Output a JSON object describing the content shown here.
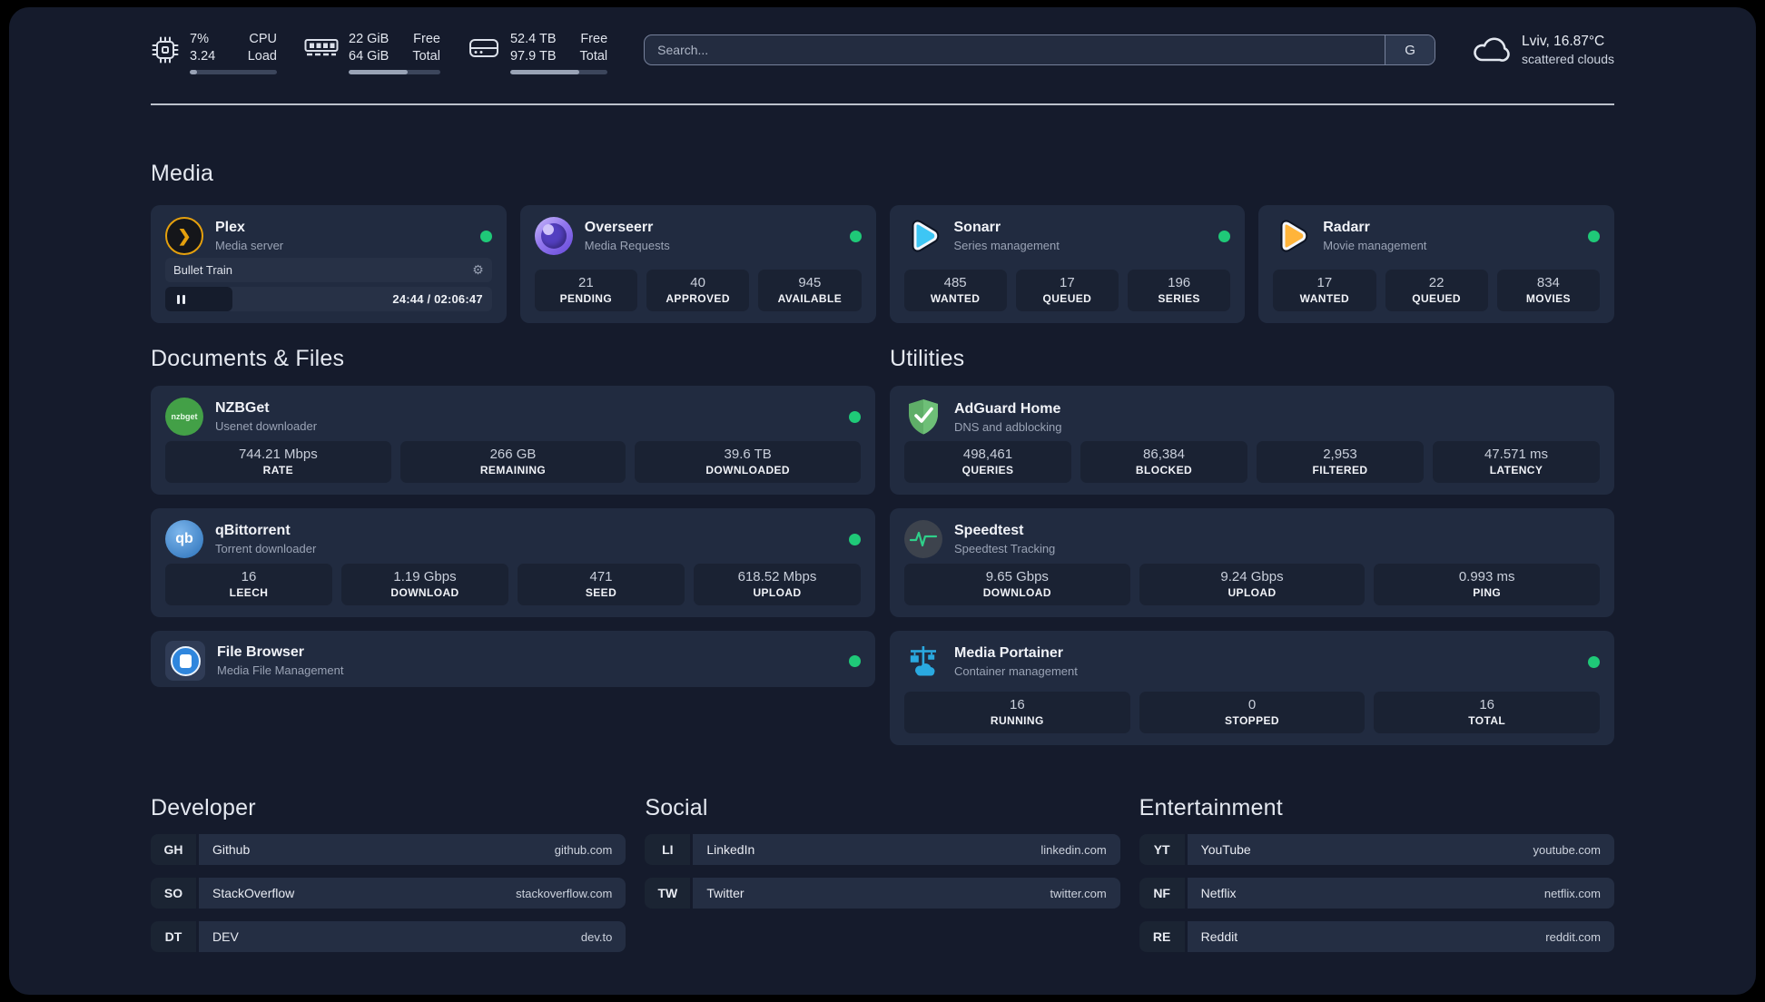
{
  "theme": {
    "background": "#151b2c",
    "card": "#212b40",
    "stat_box": "#1a2233",
    "status_online_green": "#1fc978",
    "text_primary": "#f1f3f8",
    "text_secondary": "#9aa3b5"
  },
  "icons": {
    "pause": "pause-icon",
    "gear": "⚙",
    "plex_glyph": "❯"
  },
  "topbar": {
    "cpu": {
      "values": [
        "7%",
        "3.24"
      ],
      "labels": [
        "CPU",
        "Load"
      ],
      "progress_pct": 8
    },
    "memory": {
      "values": [
        "22 GiB",
        "64 GiB"
      ],
      "labels": [
        "Free",
        "Total"
      ],
      "progress_pct": 64
    },
    "disk": {
      "values": [
        "52.4 TB",
        "97.9 TB"
      ],
      "labels": [
        "Free",
        "Total"
      ],
      "progress_pct": 71
    },
    "search": {
      "placeholder": "Search...",
      "provider": "G"
    },
    "weather": {
      "line1": "Lviv, 16.87°C",
      "line2": "scattered clouds"
    }
  },
  "sections": {
    "media": {
      "title": "Media"
    },
    "documents": {
      "title": "Documents & Files"
    },
    "utilities": {
      "title": "Utilities"
    }
  },
  "services": {
    "plex": {
      "name": "Plex",
      "desc": "Media server",
      "icon_text": "❯",
      "now_playing": {
        "title": "Bullet Train",
        "time": "24:44 / 02:06:47"
      }
    },
    "overseerr": {
      "name": "Overseerr",
      "desc": "Media Requests",
      "stats": [
        {
          "value": "21",
          "label": "PENDING"
        },
        {
          "value": "40",
          "label": "APPROVED"
        },
        {
          "value": "945",
          "label": "AVAILABLE"
        }
      ]
    },
    "sonarr": {
      "name": "Sonarr",
      "desc": "Series management",
      "stats": [
        {
          "value": "485",
          "label": "WANTED"
        },
        {
          "value": "17",
          "label": "QUEUED"
        },
        {
          "value": "196",
          "label": "SERIES"
        }
      ]
    },
    "radarr": {
      "name": "Radarr",
      "desc": "Movie management",
      "stats": [
        {
          "value": "17",
          "label": "WANTED"
        },
        {
          "value": "22",
          "label": "QUEUED"
        },
        {
          "value": "834",
          "label": "MOVIES"
        }
      ]
    },
    "nzbget": {
      "name": "NZBGet",
      "desc": "Usenet downloader",
      "icon_text": "nzbget",
      "stats": [
        {
          "value": "744.21 Mbps",
          "label": "RATE"
        },
        {
          "value": "266 GB",
          "label": "REMAINING"
        },
        {
          "value": "39.6 TB",
          "label": "DOWNLOADED"
        }
      ]
    },
    "qbittorrent": {
      "name": "qBittorrent",
      "desc": "Torrent downloader",
      "icon_text": "qb",
      "stats": [
        {
          "value": "16",
          "label": "LEECH"
        },
        {
          "value": "1.19 Gbps",
          "label": "DOWNLOAD"
        },
        {
          "value": "471",
          "label": "SEED"
        },
        {
          "value": "618.52 Mbps",
          "label": "UPLOAD"
        }
      ]
    },
    "filebrowser": {
      "name": "File Browser",
      "desc": "Media File Management"
    },
    "adguard": {
      "name": "AdGuard Home",
      "desc": "DNS and adblocking",
      "stats": [
        {
          "value": "498,461",
          "label": "QUERIES"
        },
        {
          "value": "86,384",
          "label": "BLOCKED"
        },
        {
          "value": "2,953",
          "label": "FILTERED"
        },
        {
          "value": "47.571 ms",
          "label": "LATENCY"
        }
      ]
    },
    "speedtest": {
      "name": "Speedtest",
      "desc": "Speedtest Tracking",
      "stats": [
        {
          "value": "9.65 Gbps",
          "label": "DOWNLOAD"
        },
        {
          "value": "9.24 Gbps",
          "label": "UPLOAD"
        },
        {
          "value": "0.993 ms",
          "label": "PING"
        }
      ]
    },
    "portainer": {
      "name": "Media Portainer",
      "desc": "Container management",
      "stats": [
        {
          "value": "16",
          "label": "RUNNING"
        },
        {
          "value": "0",
          "label": "STOPPED"
        },
        {
          "value": "16",
          "label": "TOTAL"
        }
      ]
    }
  },
  "bookmarks": [
    {
      "title": "Developer",
      "links": [
        {
          "abbr": "GH",
          "name": "Github",
          "url": "github.com"
        },
        {
          "abbr": "SO",
          "name": "StackOverflow",
          "url": "stackoverflow.com"
        },
        {
          "abbr": "DT",
          "name": "DEV",
          "url": "dev.to"
        }
      ]
    },
    {
      "title": "Social",
      "links": [
        {
          "abbr": "LI",
          "name": "LinkedIn",
          "url": "linkedin.com"
        },
        {
          "abbr": "TW",
          "name": "Twitter",
          "url": "twitter.com"
        }
      ]
    },
    {
      "title": "Entertainment",
      "links": [
        {
          "abbr": "YT",
          "name": "YouTube",
          "url": "youtube.com"
        },
        {
          "abbr": "NF",
          "name": "Netflix",
          "url": "netflix.com"
        },
        {
          "abbr": "RE",
          "name": "Reddit",
          "url": "reddit.com"
        }
      ]
    }
  ]
}
